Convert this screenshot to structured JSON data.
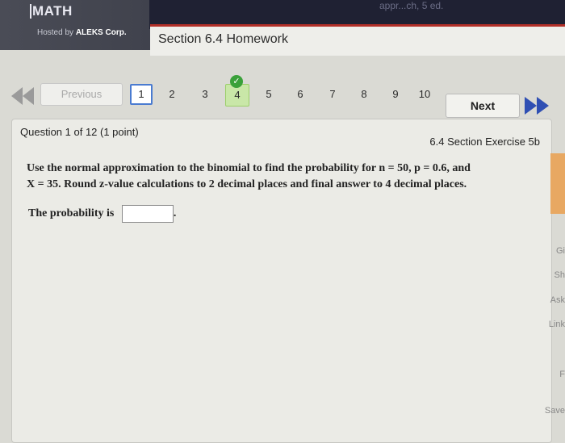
{
  "header": {
    "brand": "MATH",
    "hosted_prefix": "Hosted by ",
    "hosted_company": "ALEKS Corp.",
    "faint_text": "appr...ch, 5   ed."
  },
  "section": {
    "title": "Section 6.4 Homework"
  },
  "nav": {
    "previous_label": "Previous",
    "next_label": "Next",
    "pages": [
      "1",
      "2",
      "3",
      "4",
      "5",
      "6",
      "7",
      "8",
      "9",
      "10"
    ],
    "current_page": "1",
    "completed_page": "4",
    "check_glyph": "✓"
  },
  "question": {
    "header": "Question 1 of 12 (1 point)",
    "section_label": "6.4 Section Exercise 5b",
    "text_line1": "Use the normal approximation to the binomial to find the probability for n = 50, p = 0.6, and",
    "text_line2": "X = 35. Round z-value calculations to 2 decimal places and final answer to 4 decimal places.",
    "answer_label": "The probability is",
    "answer_value": "",
    "answer_suffix": "."
  },
  "side_panel": {
    "items": [
      "Gi",
      "Sh",
      "Ask",
      "Link",
      "F",
      "Save"
    ]
  },
  "colors": {
    "accent_red": "#b22f28",
    "complete_green": "#3aa13a",
    "current_blue": "#4a7bd0"
  }
}
